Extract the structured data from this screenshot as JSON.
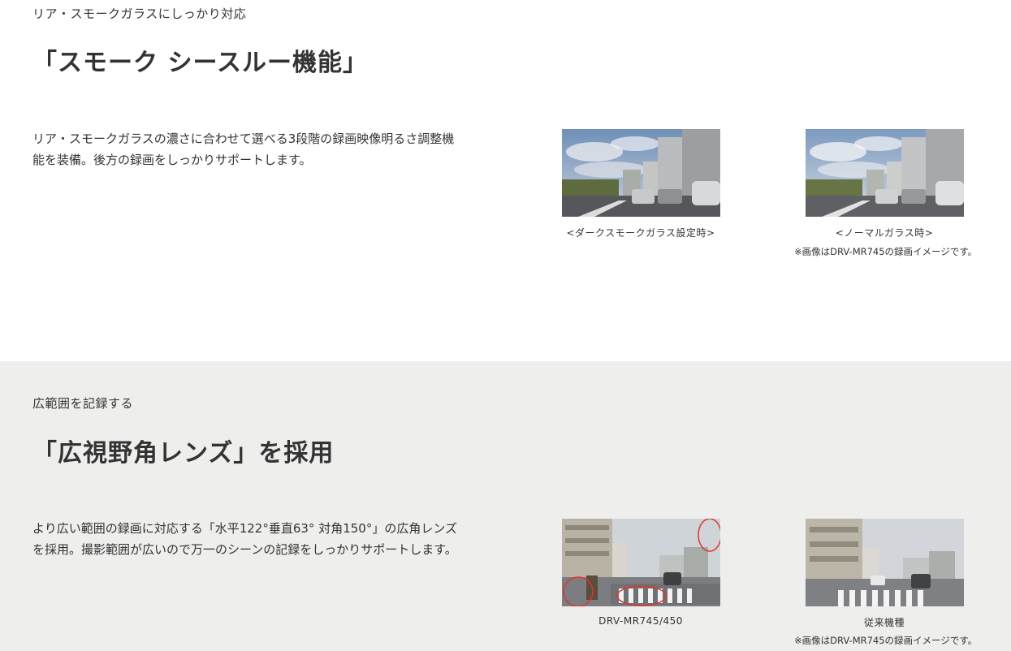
{
  "sections": [
    {
      "eyebrow": "リア・スモークガラスにしっかり対応",
      "heading": "「スモーク シースルー機能」",
      "body_line1": "リア・スモークガラスの濃さに合わせて選べる3段階の録画映像明るさ調整機",
      "body_line2": "能を装備。後方の録画をしっかりサポートします。",
      "images": [
        {
          "caption": "<ダークスモークガラス設定時>"
        },
        {
          "caption": "<ノーマルガラス時>"
        }
      ],
      "note": "※画像はDRV-MR745の録画イメージです。"
    },
    {
      "eyebrow": "広範囲を記録する",
      "heading": "「広視野角レンズ」を採用",
      "body_line1": "より広い範囲の録画に対応する「水平122°垂直63° 対角150°」の広角レンズ",
      "body_line2": "を採用。撮影範囲が広いので万一のシーンの記録をしっかりサポートします。",
      "images": [
        {
          "caption": "DRV-MR745/450"
        },
        {
          "caption": "従来機種"
        }
      ],
      "note": "※画像はDRV-MR745の録画イメージです。"
    }
  ]
}
